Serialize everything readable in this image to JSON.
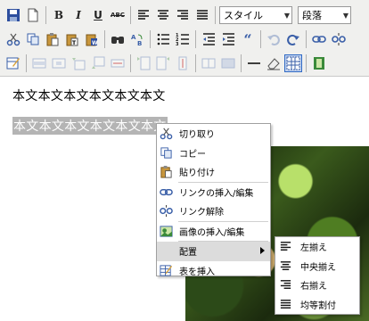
{
  "toolbar": {
    "row1": [
      {
        "icon": "save-icon"
      },
      {
        "icon": "new-document-icon"
      },
      {
        "sep": true
      },
      {
        "icon": "bold-icon",
        "text": "B"
      },
      {
        "icon": "italic-icon",
        "text": "I"
      },
      {
        "icon": "underline-icon",
        "text": "U"
      },
      {
        "icon": "strikethrough-icon",
        "text": "ABC"
      },
      {
        "sep": true
      },
      {
        "icon": "align-left-icon"
      },
      {
        "icon": "align-center-icon"
      },
      {
        "icon": "align-right-icon"
      },
      {
        "icon": "align-justify-icon"
      }
    ],
    "style_select": "スタイル",
    "format_select": "段落"
  },
  "editor": {
    "paragraph1": "本文本文本文本文本文本文",
    "paragraph2": "本文本文本文本文本文本文"
  },
  "context_menu": {
    "items": [
      {
        "label": "切り取り",
        "icon": "scissors-icon"
      },
      {
        "label": "コピー",
        "icon": "copy-icon"
      },
      {
        "label": "貼り付け",
        "icon": "paste-icon"
      },
      {
        "label": "リンクの挿入/編集",
        "icon": "link-icon"
      },
      {
        "label": "リンク解除",
        "icon": "unlink-icon"
      },
      {
        "label": "画像の挿入/編集",
        "icon": "image-icon"
      },
      {
        "label": "配置",
        "icon": ""
      },
      {
        "label": "表を挿入",
        "icon": "table-icon"
      }
    ]
  },
  "submenu": {
    "items": [
      {
        "label": "左揃え",
        "icon": "align-left-icon"
      },
      {
        "label": "中央揃え",
        "icon": "align-center-icon"
      },
      {
        "label": "右揃え",
        "icon": "align-right-icon"
      },
      {
        "label": "均等割付",
        "icon": "align-justify-icon"
      }
    ]
  },
  "colors": {
    "toolbar_bg": "#f0f0ee",
    "selection_bg": "#b4b4b4",
    "menu_hover_bg": "#dcdcdc",
    "link_blue": "#3a6fb0"
  }
}
